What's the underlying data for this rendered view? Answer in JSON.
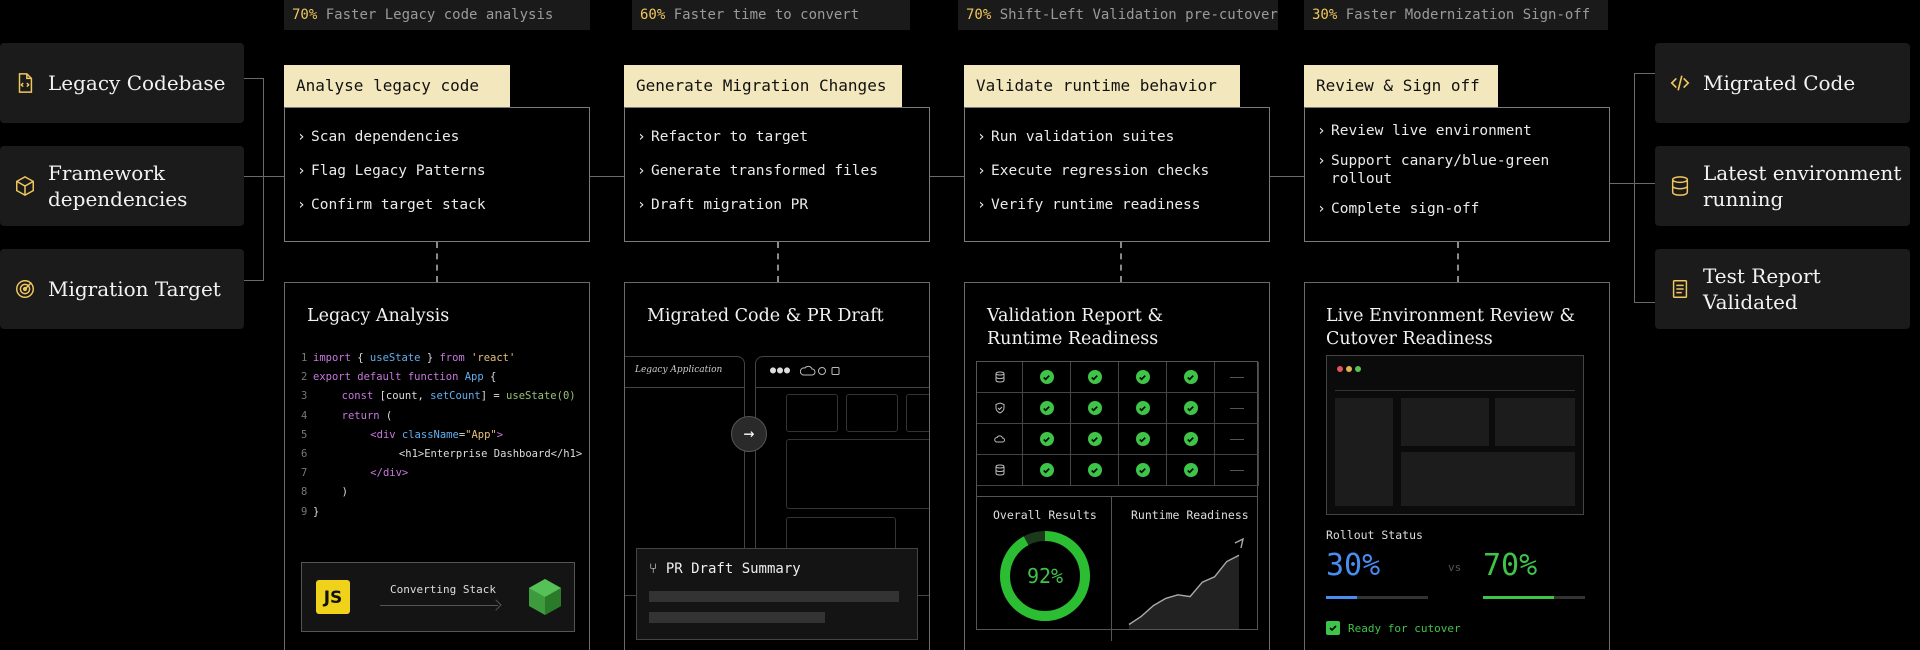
{
  "metrics": [
    {
      "pct": "70%",
      "text": "Faster Legacy code analysis"
    },
    {
      "pct": "60%",
      "text": "Faster time to convert"
    },
    {
      "pct": "70%",
      "text": "Shift-Left Validation pre-cutover"
    },
    {
      "pct": "30%",
      "text": "Faster Modernization Sign-off"
    }
  ],
  "inputs": [
    {
      "label": "Legacy Codebase",
      "icon": "file-code-icon"
    },
    {
      "label": "Framework dependencies",
      "icon": "cube-icon"
    },
    {
      "label": "Migration Target",
      "icon": "target-icon"
    }
  ],
  "outputs": [
    {
      "label": "Migrated Code",
      "icon": "code-brackets-icon"
    },
    {
      "label": "Latest environment running",
      "icon": "database-icon"
    },
    {
      "label": "Test Report Validated",
      "icon": "document-icon"
    }
  ],
  "steps": [
    {
      "title": "Analyse legacy code",
      "items": [
        "Scan dependencies",
        "Flag Legacy Patterns",
        "Confirm target stack"
      ]
    },
    {
      "title": "Generate Migration Changes",
      "items": [
        "Refactor to target",
        "Generate transformed files",
        "Draft migration PR"
      ]
    },
    {
      "title": "Validate runtime behavior",
      "items": [
        "Run validation suites",
        "Execute regression checks",
        "Verify runtime readiness"
      ]
    },
    {
      "title": "Review & Sign off",
      "items": [
        "Review live environment",
        "Support canary/blue-green rollout",
        "Complete sign-off"
      ]
    }
  ],
  "legacy_analysis": {
    "title": "Legacy Analysis",
    "code": [
      {
        "n": "1",
        "parts": [
          [
            "kw",
            "import "
          ],
          [
            "tx",
            "{ "
          ],
          [
            "fn",
            "useState"
          ],
          [
            "tx",
            " } "
          ],
          [
            "kw",
            "from "
          ],
          [
            "str",
            "'react'"
          ]
        ]
      },
      {
        "n": "2",
        "parts": [
          [
            "kw",
            "export default function "
          ],
          [
            "fn",
            "App"
          ],
          [
            "tx",
            " {"
          ]
        ]
      },
      {
        "n": "3",
        "parts": [
          [
            "tx",
            "  "
          ],
          [
            "kw",
            "const "
          ],
          [
            "tx",
            "[count, "
          ],
          [
            "fn",
            "setCount"
          ],
          [
            "tx",
            "] = "
          ],
          [
            "gr",
            "useState(0)"
          ]
        ]
      },
      {
        "n": "4",
        "parts": [
          [
            "tx",
            "  "
          ],
          [
            "kw",
            "return "
          ],
          [
            "tx",
            "("
          ]
        ]
      },
      {
        "n": "5",
        "parts": [
          [
            "tx",
            "    "
          ],
          [
            "kw",
            "<div "
          ],
          [
            "fn",
            "className"
          ],
          [
            "tx",
            "="
          ],
          [
            "str",
            "\"App\""
          ],
          [
            "kw",
            ">"
          ]
        ]
      },
      {
        "n": "6",
        "parts": [
          [
            "tx",
            "      <h1>Enterprise Dashboard</h1>"
          ]
        ]
      },
      {
        "n": "7",
        "parts": [
          [
            "tx",
            "    "
          ],
          [
            "kw",
            "</div>"
          ]
        ]
      },
      {
        "n": "8",
        "parts": [
          [
            "tx",
            "  )"
          ]
        ]
      },
      {
        "n": "9",
        "parts": [
          [
            "tx",
            "}"
          ]
        ]
      }
    ],
    "stack_label": "Converting Stack",
    "js_badge": "JS"
  },
  "migrated": {
    "title": "Migrated Code & PR Draft",
    "legacy_app_label": "Legacy Application",
    "pr_title": "PR Draft Summary",
    "icons": [
      "arrow-right-icon",
      "branch-icon",
      "dots-icon",
      "cloud-icon"
    ]
  },
  "validation": {
    "title": "Validation Report & Runtime Readiness",
    "row_icons": [
      "database-icon",
      "shield-icon",
      "cloud-icon",
      "database-icon"
    ],
    "overall_label": "Overall Results",
    "overall_value": 92,
    "overall_text": "92%",
    "runtime_label": "Runtime Readiness",
    "runtime_trend": [
      5,
      14,
      26,
      34,
      38,
      36,
      52,
      58,
      75,
      82
    ]
  },
  "live": {
    "title": "Live Environment Review & Cutover Readiness",
    "rollout_label": "Rollout Status",
    "blue_value": "30%",
    "blue_fraction": 0.3,
    "vs": "vs",
    "green_value": "70%",
    "green_fraction": 0.7,
    "ready_text": "Ready for cutover"
  },
  "colors": {
    "accent": "#f0c75e",
    "title_bg": "#f3e7bd",
    "check_green": "#3fc44a",
    "blue": "#4a8df0"
  }
}
